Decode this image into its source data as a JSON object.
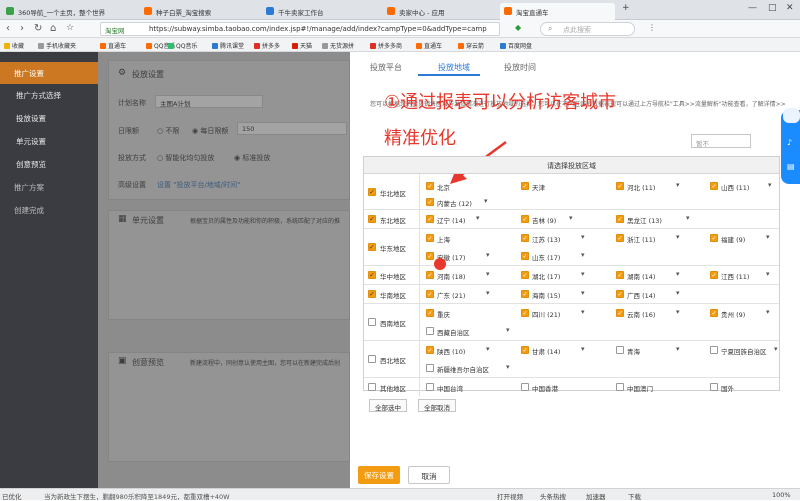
{
  "browser": {
    "tabs": [
      {
        "label": "360导航_一个主页，整个世界",
        "color": "#3aa24a"
      },
      {
        "label": "种子白票_淘宝搜索",
        "color": "#ff6a00"
      },
      {
        "label": "千牛卖家工作台",
        "color": "#2b7bd6"
      },
      {
        "label": "卖家中心 - 应用",
        "color": "#ff6a00"
      },
      {
        "label": "淘宝直通车",
        "color": "#ff6a00"
      }
    ],
    "site_badge": "淘宝网",
    "url": "https://subway.simba.taobao.com/index.jsp#!/manage/add/index?campType=0&addType=camp",
    "search_placeholder": "点此搜索",
    "bookmarks": [
      "收藏",
      "手机收藏夹",
      "直通车",
      "QQ音乐",
      "腾讯课堂",
      "拼多多",
      "天猫",
      "无货源拼",
      "拼多多商",
      "直通车",
      "穿云箭",
      "百度网盘"
    ]
  },
  "sidebar": {
    "items": [
      {
        "label": "推广设置",
        "active": true
      },
      {
        "label": "推广方式选择",
        "active": false
      },
      {
        "label": "投放设置",
        "active": false
      },
      {
        "label": "单元设置",
        "active": false
      },
      {
        "label": "创意预览",
        "active": false
      },
      {
        "label": "推广方案",
        "active": false
      },
      {
        "label": "创建完成",
        "active": false
      }
    ]
  },
  "content": {
    "section1_title": "投放设置",
    "plan_name_label": "计划名称",
    "plan_name_value": "主图A计划",
    "budget_label": "日限额",
    "budget_opt1": "不限",
    "budget_opt2": "每日限额",
    "budget_value": "150",
    "method_label": "投放方式",
    "method_opt1": "智能化均匀投放",
    "method_opt2": "标准投放",
    "advanced_label": "高级设置",
    "advanced_link": "设置 \"投放平台/地域/时间\"",
    "section2_title": "单元设置",
    "section2_desc": "根据宝贝的属性及功能和你的积极，系统匹配了对应的推",
    "section3_title": "创意预览",
    "section3_desc": "新建流程中，同创意认使用主图，您可以在新建完成后创"
  },
  "panel": {
    "tabs": [
      "投放平台",
      "投放地域",
      "投放时间"
    ],
    "active_tab": 1,
    "annotation_line1": "①通过报表可以分析访客城市",
    "annotation_line2": "精准优化",
    "description": "您可以根据您的宝贝销售区域与发货情况进行投放地域的选择。您可以在不同区域的数据表现可以通过上方导航栏\"工具>>流量解析\"功能查看，了解详情>>",
    "filter_placeholder": "暂不",
    "table_title": "请选择投放区域",
    "rows": [
      {
        "group": "华北地区",
        "checked": true,
        "cells": [
          {
            "label": "北京",
            "checked": true,
            "dd": false
          },
          {
            "label": "天津",
            "checked": true,
            "dd": false
          },
          {
            "label": "河北 (11)",
            "checked": true,
            "dd": true
          },
          {
            "label": "山西 (11)",
            "checked": true,
            "dd": true
          },
          {
            "label": "内蒙古 (12)",
            "checked": true,
            "dd": true
          }
        ]
      },
      {
        "group": "东北地区",
        "checked": true,
        "cells": [
          {
            "label": "辽宁 (14)",
            "checked": true,
            "dd": true
          },
          {
            "label": "吉林 (9)",
            "checked": true,
            "dd": true
          },
          {
            "label": "黑龙江 (13)",
            "checked": true,
            "dd": true
          }
        ]
      },
      {
        "group": "华东地区",
        "checked": true,
        "cells": [
          {
            "label": "上海",
            "checked": true,
            "dd": false
          },
          {
            "label": "江苏 (13)",
            "checked": true,
            "dd": true
          },
          {
            "label": "浙江 (11)",
            "checked": true,
            "dd": true
          },
          {
            "label": "福建 (9)",
            "checked": true,
            "dd": true
          },
          {
            "label": "安徽 (17)",
            "checked": true,
            "dd": true
          },
          {
            "label": "山东 (17)",
            "checked": true,
            "dd": true
          }
        ]
      },
      {
        "group": "华中地区",
        "checked": true,
        "cells": [
          {
            "label": "河南 (18)",
            "checked": true,
            "dd": true
          },
          {
            "label": "湖北 (17)",
            "checked": true,
            "dd": true
          },
          {
            "label": "湖南 (14)",
            "checked": true,
            "dd": true
          },
          {
            "label": "江西 (11)",
            "checked": true,
            "dd": true
          }
        ]
      },
      {
        "group": "华南地区",
        "checked": true,
        "cells": [
          {
            "label": "广东 (21)",
            "checked": true,
            "dd": true
          },
          {
            "label": "海南 (15)",
            "checked": true,
            "dd": true
          },
          {
            "label": "广西 (14)",
            "checked": true,
            "dd": true
          }
        ]
      },
      {
        "group": "西南地区",
        "checked": false,
        "cells": [
          {
            "label": "重庆",
            "checked": true,
            "dd": false
          },
          {
            "label": "四川 (21)",
            "checked": true,
            "dd": true
          },
          {
            "label": "云南 (16)",
            "checked": true,
            "dd": true
          },
          {
            "label": "贵州 (9)",
            "checked": true,
            "dd": true
          },
          {
            "label": "西藏自治区",
            "checked": false,
            "dd": true
          }
        ]
      },
      {
        "group": "西北地区",
        "checked": false,
        "cells": [
          {
            "label": "陕西 (10)",
            "checked": true,
            "dd": true
          },
          {
            "label": "甘肃 (14)",
            "checked": true,
            "dd": true
          },
          {
            "label": "青海",
            "checked": false,
            "dd": true
          },
          {
            "label": "宁夏回族自治区",
            "checked": false,
            "dd": true
          },
          {
            "label": "新疆维吾尔自治区",
            "checked": false,
            "dd": true
          }
        ]
      },
      {
        "group": "其他地区",
        "checked": false,
        "cells": [
          {
            "label": "中国台湾",
            "checked": false,
            "dd": false
          },
          {
            "label": "中国香港",
            "checked": false,
            "dd": false
          },
          {
            "label": "中国澳门",
            "checked": false,
            "dd": false
          },
          {
            "label": "国外",
            "checked": false,
            "dd": false
          }
        ]
      }
    ],
    "select_all": "全部选中",
    "clear_all": "全部取消",
    "save": "保存设置",
    "cancel": "取消"
  },
  "statusbar": {
    "left": "已优化",
    "news": "当为新政生下摆生，鹏翻980乐积降至1849元，都重双槽+40W",
    "right": [
      "打开视频",
      "头条热搜",
      "加速器",
      "下载",
      "100%"
    ]
  },
  "colors": {
    "accent": "#f39c12",
    "link": "#2b7bd6",
    "annotation": "#e8372c",
    "sidebar_active": "#cc7722"
  }
}
